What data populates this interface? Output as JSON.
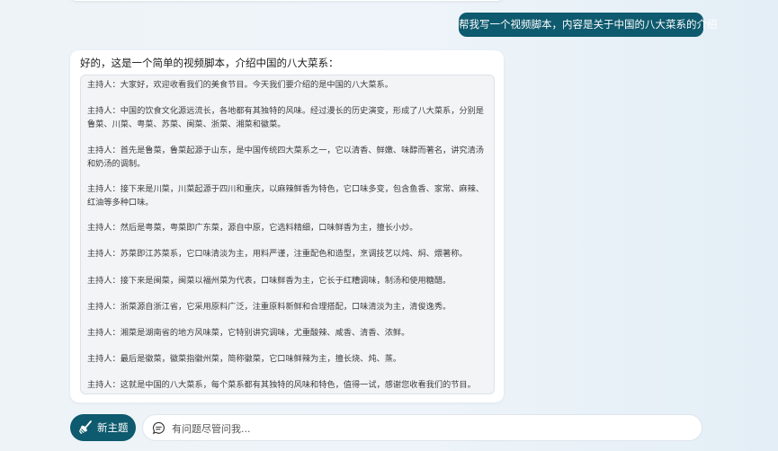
{
  "user_message": "帮我写一个视频脚本，内容是关于中国的八大菜系的介绍",
  "assistant": {
    "intro": "好的，这是一个简单的视频脚本，介绍中国的八大菜系：",
    "script_lines": [
      "主持人：大家好，欢迎收看我们的美食节目。今天我们要介绍的是中国的八大菜系。",
      "主持人：中国的饮食文化源远流长，各地都有其独特的风味。经过漫长的历史演变，形成了八大菜系，分别是鲁菜、川菜、粤菜、苏菜、闽菜、浙菜、湘菜和徽菜。",
      "主持人：首先是鲁菜，鲁菜起源于山东，是中国传统四大菜系之一，它以清香、鲜嫩、味醇而著名，讲究清汤和奶汤的调制。",
      "主持人：接下来是川菜，川菜起源于四川和重庆，以麻辣鲜香为特色，它口味多变，包含鱼香、家常、麻辣、红油等多种口味。",
      "主持人：然后是粤菜，粤菜即广东菜，源自中原，它选料精细，口味鲜香为主，擅长小炒。",
      "主持人：苏菜即江苏菜系，它口味清淡为主，用料严谨，注重配色和造型，烹调技艺以炖、焖、煨著称。",
      "主持人：接下来是闽菜，闽菜以福州菜为代表，口味鲜香为主，它长于红糟调味，制汤和使用糖醋。",
      "主持人：浙菜源自浙江省，它采用原料广泛，注重原料新鲜和合理搭配，口味清淡为主，清俊逸秀。",
      "主持人：湘菜是湖南省的地方风味菜，它特别讲究调味，尤重酸辣、咸香、清香、浓鲜。",
      "主持人：最后是徽菜，徽菜指徽州菜，简称徽菜，它口味鲜辣为主，擅长烧、炖、蒸。",
      "主持人：这就是中国的八大菜系，每个菜系都有其独特的风味和特色，值得一试，感谢您收看我们的节目。"
    ]
  },
  "toolbar": {
    "new_topic_label": "新主题",
    "input_placeholder": "有问题尽管问我...",
    "input_value": ""
  },
  "icons": {
    "new_topic": "broom-icon",
    "chat": "chat-bubble-icon"
  },
  "colors": {
    "accent": "#0e5a6e",
    "background": "#eef3f8",
    "card": "#ffffff",
    "script_box": "#f2f4f6"
  }
}
